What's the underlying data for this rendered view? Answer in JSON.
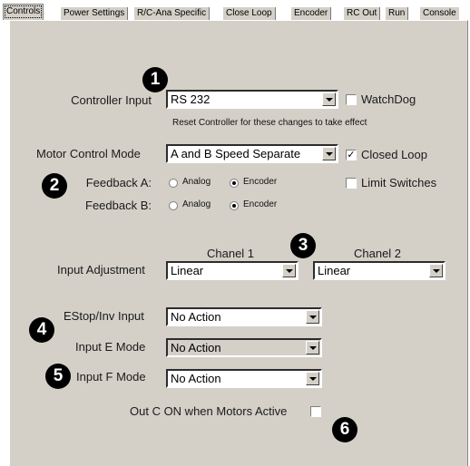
{
  "tabs": [
    "Controls",
    "Power Settings",
    "R/C-Ana Specific",
    "Close Loop",
    "Encoder",
    "RC Out",
    "Run",
    "Console"
  ],
  "controller_input": {
    "label": "Controller Input",
    "value": "RS 232",
    "watchdog_label": "WatchDog",
    "note": "Reset Controller for these changes to take effect"
  },
  "motor_control": {
    "label": "Motor Control Mode",
    "value": "A and B Speed Separate",
    "closed_loop_label": "Closed Loop",
    "closed_loop_check": "✓"
  },
  "feedback": {
    "a_label": "Feedback A:",
    "b_label": "Feedback B:",
    "analog": "Analog",
    "encoder": "Encoder",
    "limit_switches_label": "Limit Switches"
  },
  "input_adjustment": {
    "label": "Input Adjustment",
    "ch1_label": "Chanel 1",
    "ch2_label": "Chanel 2",
    "ch1_value": "Linear",
    "ch2_value": "Linear"
  },
  "estop": {
    "label": "EStop/Inv Input",
    "value": "No Action"
  },
  "input_e": {
    "label": "Input E Mode",
    "value": "No Action"
  },
  "input_f": {
    "label": "Input F Mode",
    "value": "No Action"
  },
  "out_c": {
    "label": "Out C ON when Motors Active"
  },
  "badges": [
    "1",
    "2",
    "3",
    "4",
    "5",
    "6"
  ]
}
